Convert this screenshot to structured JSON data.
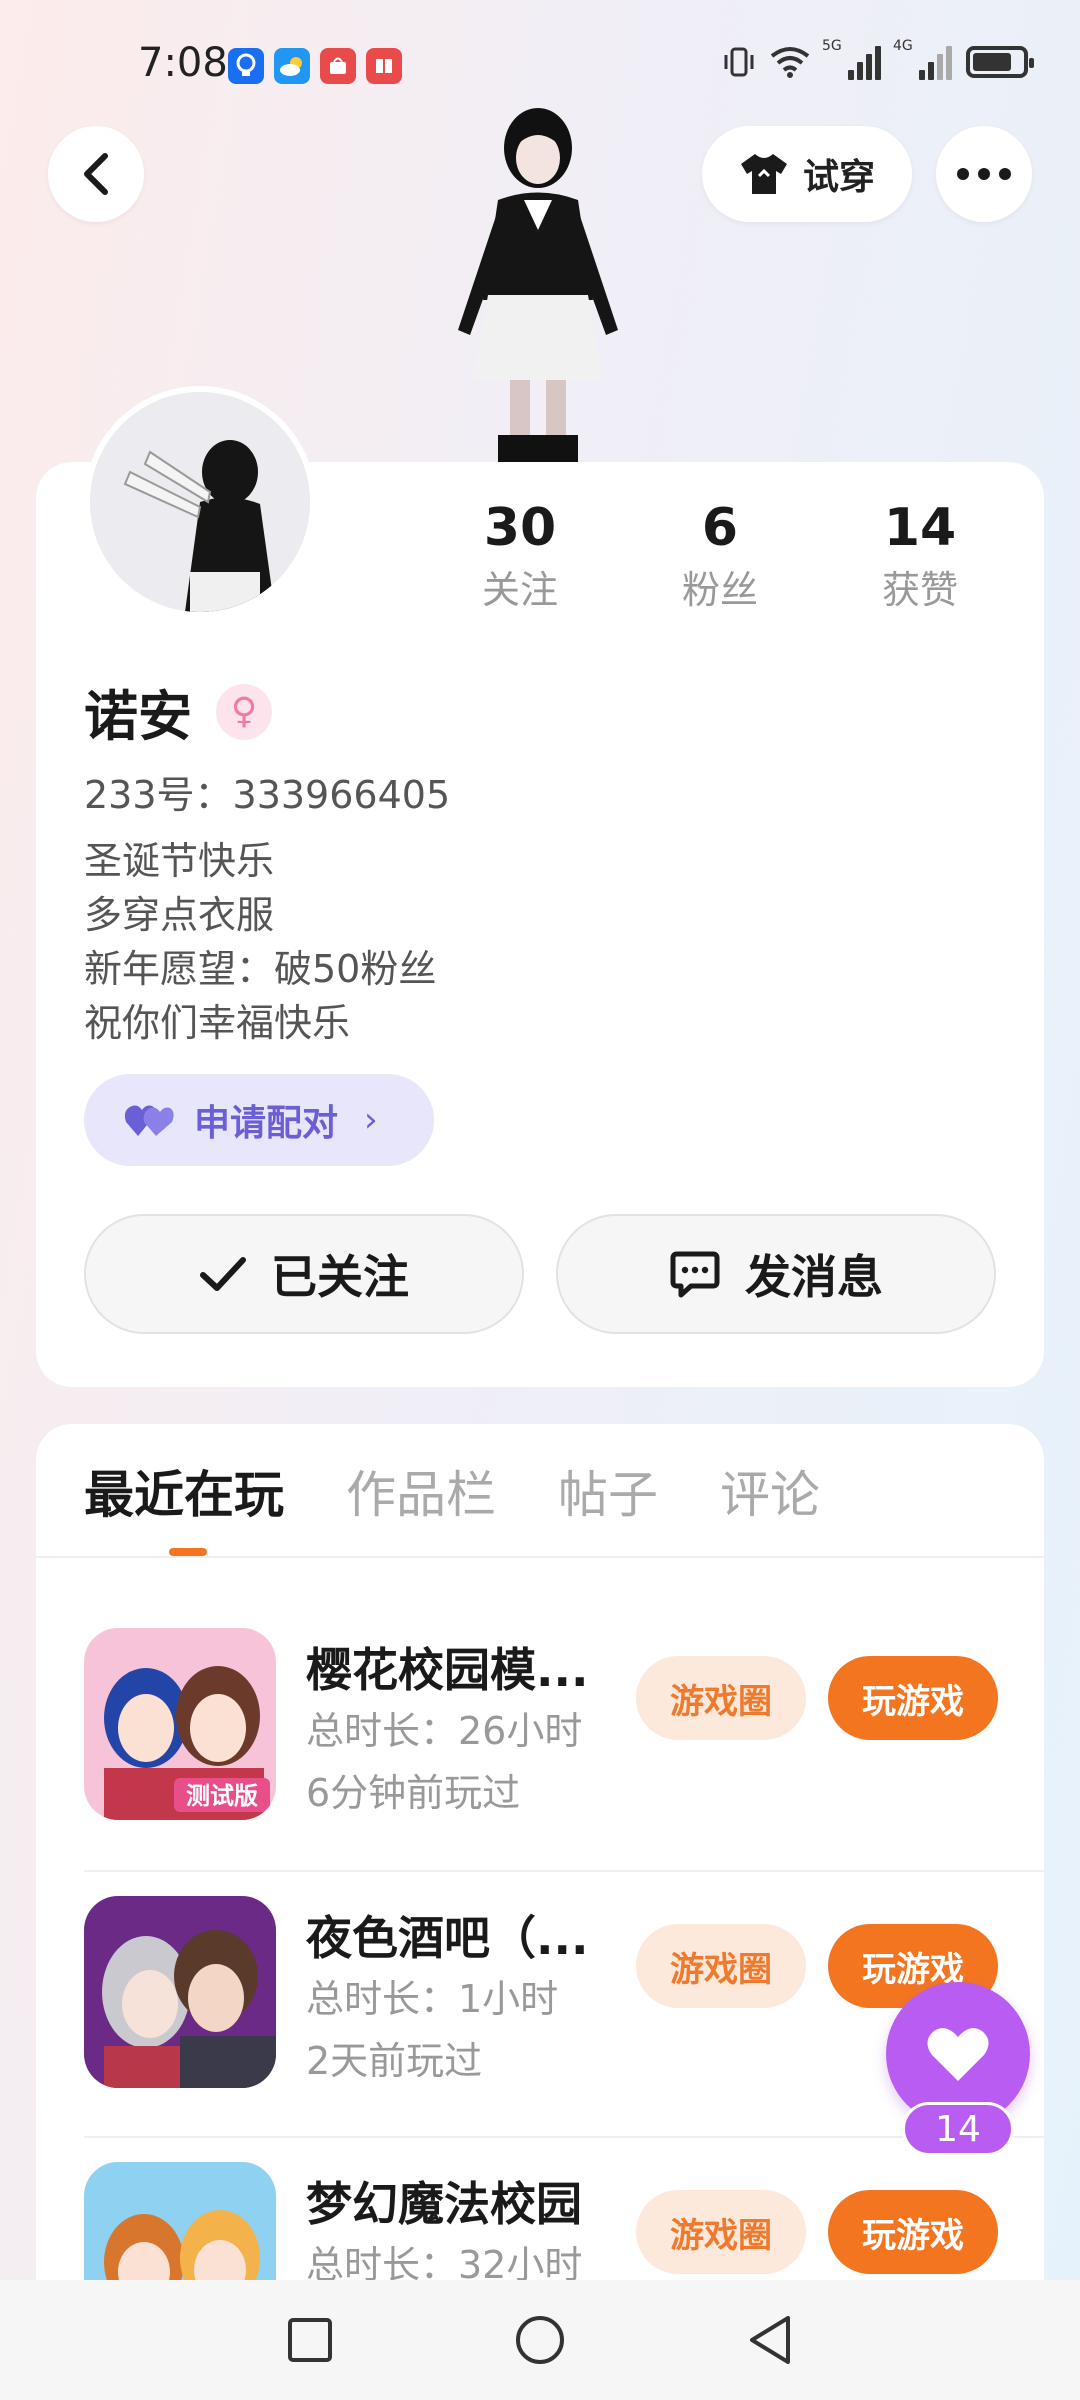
{
  "status_bar": {
    "time": "7:08",
    "network_5g": "5G",
    "network_4g": "4G"
  },
  "header": {
    "tryon_label": "试穿"
  },
  "profile": {
    "name": "诺安",
    "gender_symbol": "♀",
    "uid": "233号：333966405",
    "stats": [
      {
        "value": "30",
        "label": "关注"
      },
      {
        "value": "6",
        "label": "粉丝"
      },
      {
        "value": "14",
        "label": "获赞"
      }
    ],
    "bio": [
      "圣诞节快乐",
      "多穿点衣服",
      "新年愿望：破50粉丝",
      "祝你们幸福快乐"
    ],
    "pair_label": "申请配对",
    "follow_label": "已关注",
    "message_label": "发消息"
  },
  "tabs": [
    "最近在玩",
    "作品栏",
    "帖子",
    "评论"
  ],
  "games": [
    {
      "name": "樱花校园模...",
      "time": "总时长：26小时",
      "last": "6分钟前玩过",
      "circle_label": "游戏圈",
      "play_label": "玩游戏",
      "badge": "测试版"
    },
    {
      "name": "夜色酒吧（...",
      "time": "总时长：1小时",
      "last": "2天前玩过",
      "circle_label": "游戏圈",
      "play_label": "玩游戏"
    },
    {
      "name": "梦幻魔法校园",
      "time": "总时长：32小时",
      "last": "",
      "circle_label": "游戏圈",
      "play_label": "玩游戏"
    }
  ],
  "like_fab": {
    "count": "14"
  },
  "colors": {
    "accent": "#f47520",
    "purple": "#b85cf2",
    "pair": "#6a5fd4"
  }
}
